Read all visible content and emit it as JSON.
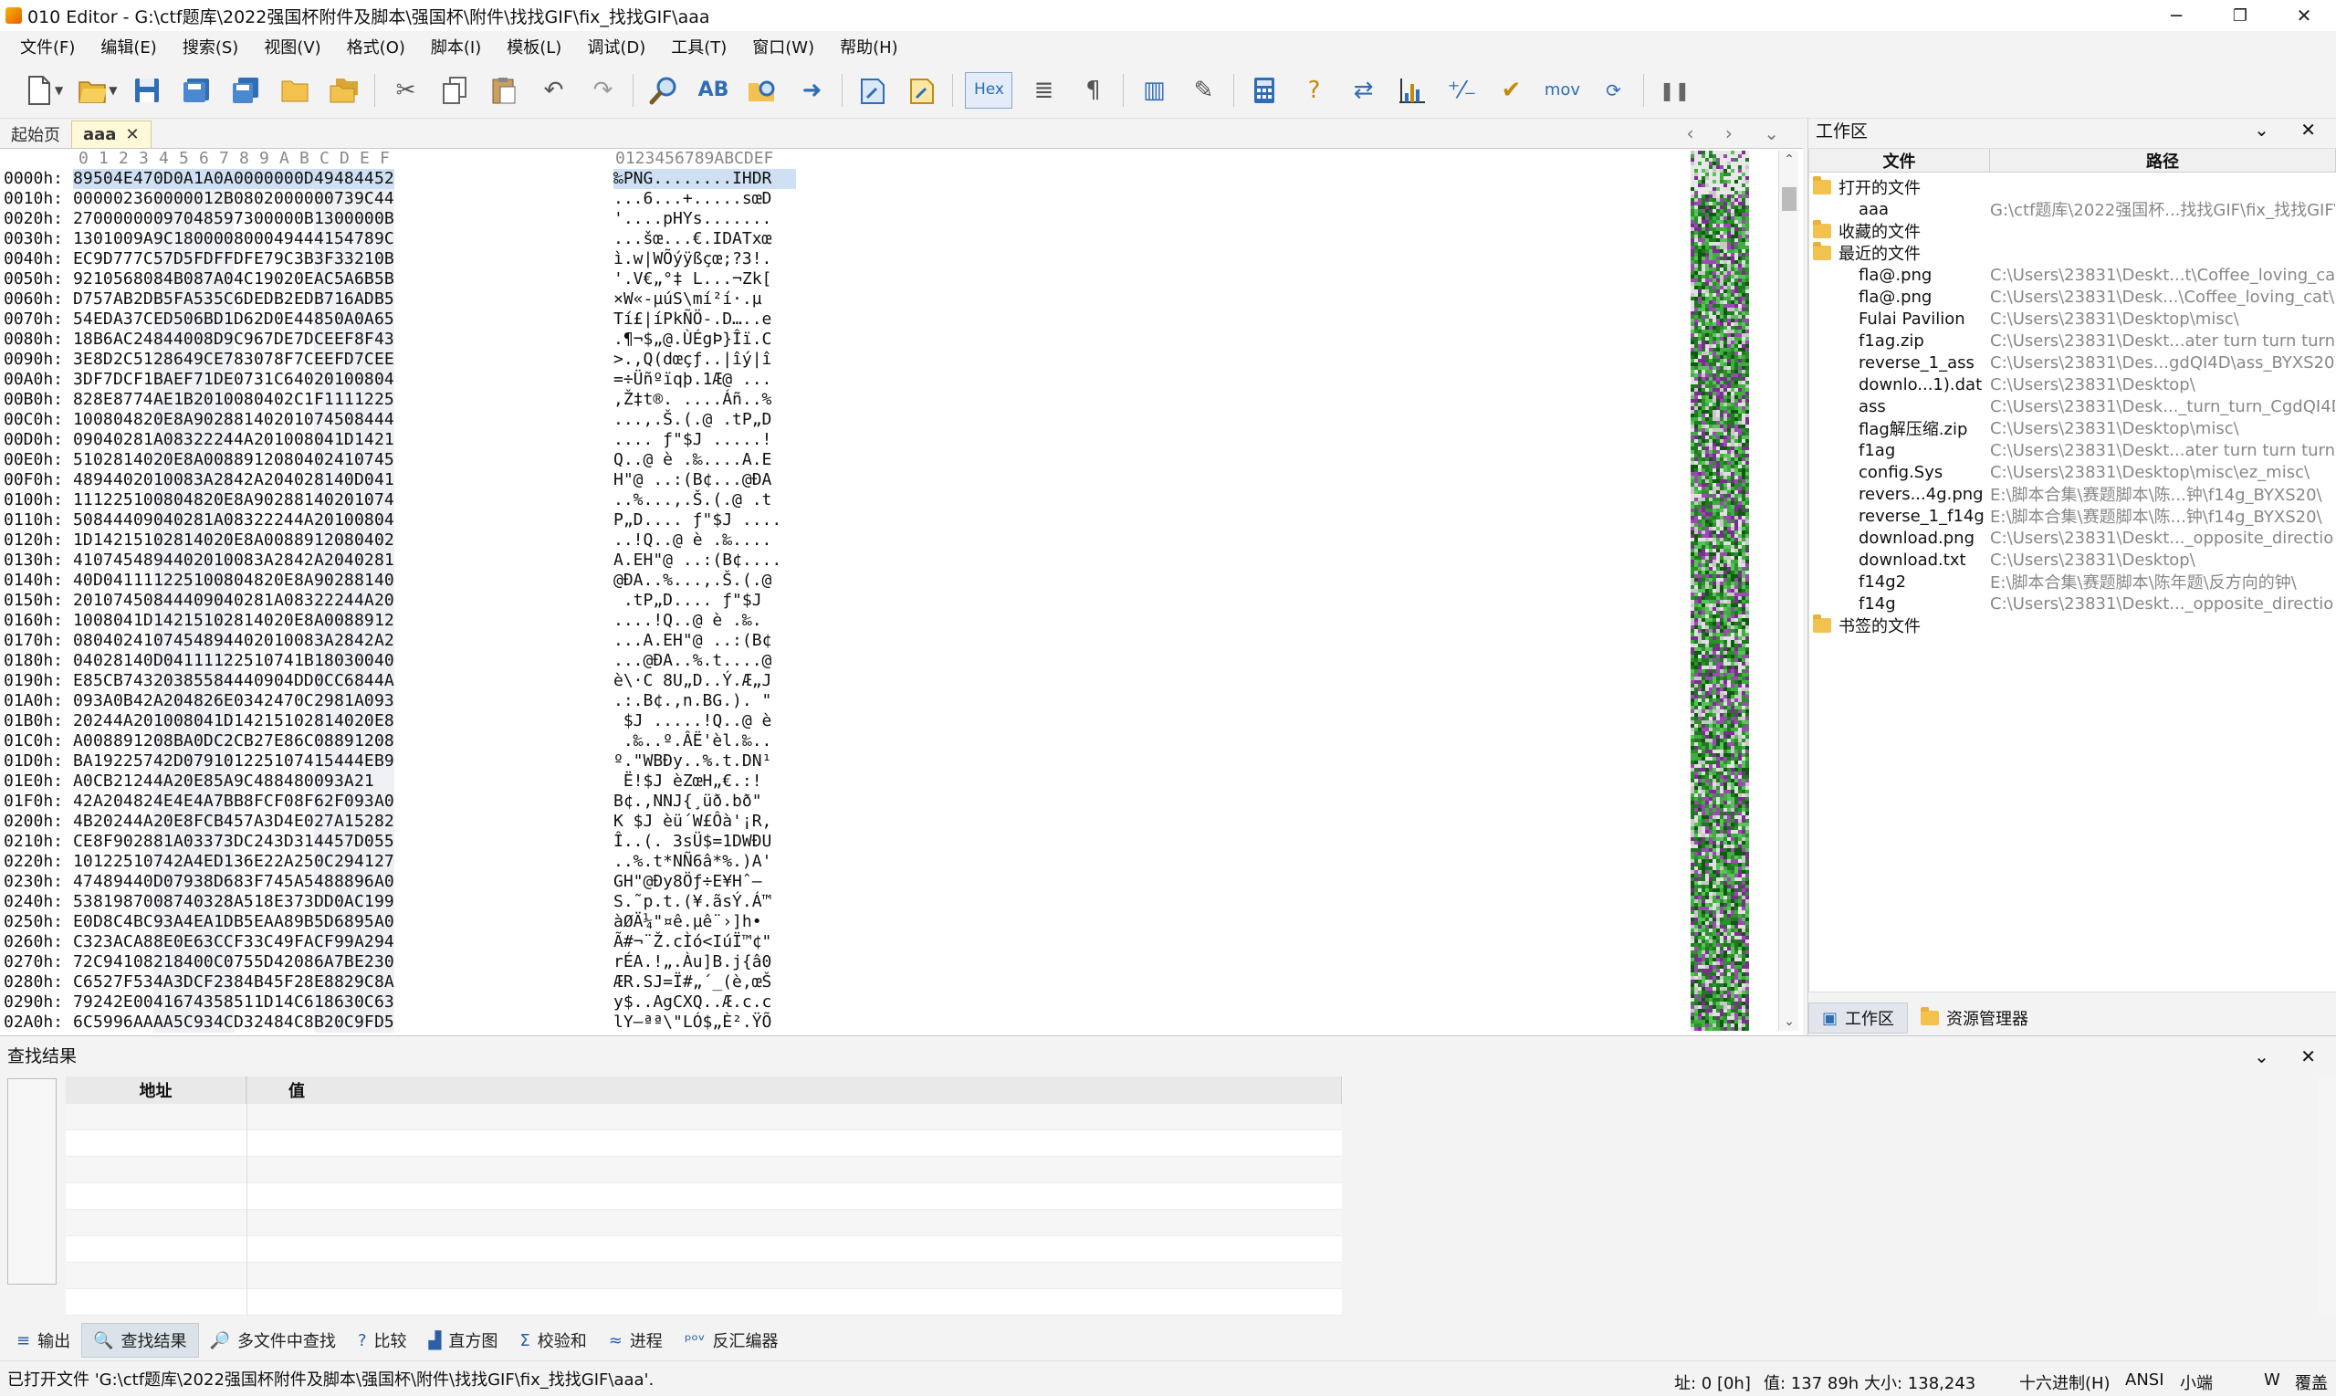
{
  "window": {
    "title": "010 Editor - G:\\ctf题库\\2022强国杯附件及脚本\\强国杯\\附件\\找找GIF\\fix_找找GIF\\aaa",
    "minimize": "─",
    "maximize": "❐",
    "close": "✕"
  },
  "menu": [
    "文件(F)",
    "编辑(E)",
    "搜索(S)",
    "视图(V)",
    "格式(O)",
    "脚本(I)",
    "模板(L)",
    "调试(D)",
    "工具(T)",
    "窗口(W)",
    "帮助(H)"
  ],
  "toolbar": {
    "hex_label": "Hex",
    "mov_label": "mov",
    "icons": [
      "new-file-icon",
      "open-file-icon",
      "save-icon",
      "save-as-icon",
      "save-all-icon",
      "open-folder-icon",
      "open-multiple-icon",
      "cut-icon",
      "copy-icon",
      "paste-icon",
      "undo-icon",
      "redo-icon",
      "find-icon",
      "find-replace-icon",
      "find-in-files-icon",
      "goto-icon",
      "run-script-icon",
      "run-template-icon",
      "hex-mode-icon",
      "line-wrap-icon",
      "show-whitespace-icon",
      "columns-icon",
      "highlight-icon",
      "calculator-icon",
      "inspector-icon",
      "compare-icon",
      "histogram-icon",
      "checksum-icon",
      "verify-icon",
      "disassembler-icon",
      "base-converter-icon",
      "pause-icon"
    ]
  },
  "tabs": [
    {
      "label": "起始页",
      "active": false
    },
    {
      "label": "aaa",
      "active": true,
      "close": "✕"
    }
  ],
  "tab_nav": "‹ › ⌄",
  "hex": {
    "column_header": [
      "0",
      "1",
      "2",
      "3",
      "4",
      "5",
      "6",
      "7",
      "8",
      "9",
      "A",
      "B",
      "C",
      "D",
      "E",
      "F"
    ],
    "ascii_header": "0123456789ABCDEF",
    "rows": [
      {
        "addr": "0000h:",
        "bytes": "89 50 4E 47 0D 0A 1A 0A 00 00 00 0D 49 48 44 52",
        "ascii": "‰PNG........IHDR"
      },
      {
        "addr": "0010h:",
        "bytes": "00 00 02 36 00 00 01 2B 08 02 00 00 00 73 9C 44",
        "ascii": "...6...+.....sœD"
      },
      {
        "addr": "0020h:",
        "bytes": "27 00 00 00 09 70 48 59 73 00 00 0B 13 00 00 0B",
        "ascii": "'....pHYs......."
      },
      {
        "addr": "0030h:",
        "bytes": "13 01 00 9A 9C 18 00 00 80 00 49 44 41 54 78 9C",
        "ascii": "...šœ...€.IDATxœ"
      },
      {
        "addr": "0040h:",
        "bytes": "EC 9D 77 7C 57 D5 FD FF DF E7 9C 3B 3F 33 21 0B",
        "ascii": "ì.w|WÕýÿßçœ;?3!."
      },
      {
        "addr": "0050h:",
        "bytes": "92 10 56 80 84 B0 87 A0 4C 19 02 0E AC 5A 6B 5B",
        "ascii": "'.V€„°‡ L...¬Zk["
      },
      {
        "addr": "0060h:",
        "bytes": "D7 57 AB 2D B5 FA 53 5C 6D ED B2 ED B7 16 AD B5",
        "ascii": "×W«-µúS\\mí²í·.­µ"
      },
      {
        "addr": "0070h:",
        "bytes": "54 ED A3 7C ED 50 6B D1 D6 2D 0E 44 85 0A 0A 65",
        "ascii": "Tí£|íPkÑÖ-.D…..e"
      },
      {
        "addr": "0080h:",
        "bytes": "18 B6 AC 24 84 40 08 D9 C9 67 DE 7D CE EF 8F 43",
        "ascii": ".¶¬$„@.ÙÉgÞ}Îï.C"
      },
      {
        "addr": "0090h:",
        "bytes": "3E 8D 2C 51 28 64 9C E7 83 07 8F 7C EE FD 7C EE",
        "ascii": ">.,Q(dœçƒ..|îý|î"
      },
      {
        "addr": "00A0h:",
        "bytes": "3D F7 DC F1 BA EF 71 DE 07 31 C6 40 20 10 08 04",
        "ascii": "=÷Üñºïqþ.1Æ@ ..."
      },
      {
        "addr": "00B0h:",
        "bytes": "82 8E 87 74 AE 1B 20 10 08 04 02 C1 F1 11 12 25",
        "ascii": ",Ž‡t®. ....Áñ..%"
      },
      {
        "addr": "00C0h:",
        "bytes": "10 08 04 82 0E 8A 90 28 81 40 20 10 74 50 84 44",
        "ascii": "...,.Š.(.@ .tP„D"
      },
      {
        "addr": "00D0h:",
        "bytes": "09 04 02 81 A0 83 22 24 4A 20 10 08 04 1D 14 21",
        "ascii": ".... ƒ\"$J .....!"
      },
      {
        "addr": "00E0h:",
        "bytes": "51 02 81 40 20 E8 A0 08 89 12 08 04 02 41 07 45",
        "ascii": "Q..@ è .‰....A.E"
      },
      {
        "addr": "00F0h:",
        "bytes": "48 94 40 20 10 08 3A 28 42 A2 04 02 81 40 D0 41",
        "ascii": "H\"@ ..:(B¢...@ÐA"
      },
      {
        "addr": "0100h:",
        "bytes": "11 12 25 10 08 04 82 0E 8A 90 28 81 40 20 10 74",
        "ascii": "..%...,.Š.(.@ .t"
      },
      {
        "addr": "0110h:",
        "bytes": "50 84 44 09 04 02 81 A0 83 22 24 4A 20 10 08 04",
        "ascii": "P„D.... ƒ\"$J ...."
      },
      {
        "addr": "0120h:",
        "bytes": "1D 14 21 51 02 81 40 20 E8 A0 08 89 12 08 04 02",
        "ascii": "..!Q..@ è .‰...."
      },
      {
        "addr": "0130h:",
        "bytes": "41 07 45 48 94 40 20 10 08 3A 28 42 A2 04 02 81",
        "ascii": "A.EH\"@ ..:(B¢...."
      },
      {
        "addr": "0140h:",
        "bytes": "40 D0 41 11 12 25 10 08 04 82 0E 8A 90 28 81 40",
        "ascii": "@ÐA..%...,.Š.(.@"
      },
      {
        "addr": "0150h:",
        "bytes": "20 10 74 50 84 44 09 04 02 81 A0 83 22 24 4A 20",
        " ascii": "",
        "ascii": " .tP„D.... ƒ\"$J "
      },
      {
        "addr": "0160h:",
        "bytes": "10 08 04 1D 14 21 51 02 81 40 20 E8 A0 08 89 12",
        "ascii": "....!Q..@ è .‰."
      },
      {
        "addr": "0170h:",
        "bytes": "08 04 02 41 07 45 48 94 40 20 10 08 3A 28 42 A2",
        "ascii": "...A.EH\"@ ..:(B¢"
      },
      {
        "addr": "0180h:",
        "bytes": "04 02 81 40 D0 41 11 12 25 10 74 1B 18 03 00 40",
        "ascii": "...@ÐA..%.t....@"
      },
      {
        "addr": "0190h:",
        "bytes": "E8 5C B7 43 20 38 55 84 44 09 04 DD 0C C6 84 4A",
        "ascii": "è\\·C 8U„D..Ý.Æ„J"
      },
      {
        "addr": "01A0h:",
        "bytes": "09 3A 0B 42 A2 04 82 6E 03 42 47 0C 29 81 A0 93",
        "ascii": ".:.B¢.,n.BG.). \""
      },
      {
        "addr": "01B0h:",
        "bytes": "20 24 4A 20 10 08 04 1D 14 21 51 02 81 40 20 E8",
        "ascii": " $J .....!Q..@ è"
      },
      {
        "addr": "01C0h:",
        "bytes": "A0 08 89 12 08 BA 0D C2 CB 27 E8 6C 08 89 12 08",
        "ascii": " .‰..º.ÂË'èl.‰.."
      },
      {
        "addr": "01D0h:",
        "bytes": "BA 19 22 57 42 D0 79 10 12 25 10 74 15 44 4E B9",
        "ascii": "º.\"WBÐy..%.t.DN¹"
      },
      {
        "addr": "01E0h:",
        "bytes": "A0 CB 21 24 4A 20 E8 5A 9C 48 84 80 09 3A 21",
        " ascii": "",
        "ascii": " Ë!$J èZœH„€.:!"
      },
      {
        "addr": "01F0h:",
        "bytes": "42 A2 04 82 4E 4E 4A 7B B8 FC F0 8F 62 F0 93 A0",
        "ascii": "B¢.,NNJ{¸üð.bð\" "
      },
      {
        "addr": "0200h:",
        "bytes": "4B 20 24 4A 20 E8 FC B4 57 A3 D4 E0 27 A1 52 82",
        "ascii": "K $J èü´W£Ôà'¡R,"
      },
      {
        "addr": "0210h:",
        "bytes": "CE 8F 90 28 81 A0 33 73 DC 24 3D 31 44 57 D0 55",
        "ascii": "Î..(. 3sÜ$=1DWÐU"
      },
      {
        "addr": "0220h:",
        "bytes": "10 12 25 10 74 2A 4E D1 36 E2 2A 25 0C 29 41 27",
        "ascii": "..%.t*NÑ6â*%.)A'"
      },
      {
        "addr": "0230h:",
        "bytes": "47 48 94 40 D0 79 38 D6 83 F7 45 A5 48 88 96 A0",
        "ascii": "GH\"@Ðy8Öƒ÷E¥Hˆ– "
      },
      {
        "addr": "0240h:",
        "bytes": "53 81 98 70 08 74 03 28 A5 18 E3 73 DD 0A C1 99",
        "ascii": "S.˜p.t.(¥.ãsÝ.Á™"
      },
      {
        "addr": "0250h:",
        "bytes": "E0 D8 C4 BC 93 A4 EA 1D B5 EA A8 9B 5D 68 95 A0",
        "ascii": "àØÄ¼\"¤ê.µê¨›]h• "
      },
      {
        "addr": "0260h:",
        "bytes": "C3 23 AC A8 8E 0E 63 CC F3 3C 49 FA CF 99 A2 94",
        "ascii": "Ã#¬¨Ž.cÌó<IúÏ™¢\""
      },
      {
        "addr": "0270h:",
        "bytes": "72 C9 41 08 21 84 00 C0 75 5D 42 08 6A 7B E2 30",
        "ascii": "rÉA.!„.Àu]B.j{â0"
      },
      {
        "addr": "0280h:",
        "bytes": "C6 52 7F 53 4A 3D CF 23 84 B4 5F 28 E8 82 9C 8A",
        "ascii": "ÆR.SJ=Ï#„´_(è,œŠ"
      },
      {
        "addr": "0290h:",
        "bytes": "79 24 2E 00 41 67 43 58 51 1D 14 C6 18 63 0C 63",
        "ascii": "y$..AgCXQ..Æ.c.c"
      },
      {
        "addr": "02A0h:",
        "bytes": "6C 59 96 AA AA 5C 93 4C D3 24 84 C8 B2 0C 9F D5",
        "ascii": "lY–ªª\\\"LÓ$„È².ŸÕ"
      }
    ]
  },
  "workspace": {
    "title": "工作区",
    "ctl": "⌄ ✕",
    "col_file": "文件",
    "col_path": "路径",
    "groups": {
      "open": "打开的文件",
      "favorites": "收藏的文件",
      "recent": "最近的文件",
      "bookmarks": "书签的文件"
    },
    "open_files": [
      {
        "name": "aaa",
        "path": "G:\\ctf题库\\2022强国杯...找找GIF\\fix_找找GIF\\"
      }
    ],
    "recent_files": [
      {
        "name": "fla@.png",
        "path": "C:\\Users\\23831\\Deskt...t\\Coffee_loving_cat\\"
      },
      {
        "name": "fla@.png",
        "path": "C:\\Users\\23831\\Desk...\\Coffee_loving_cat\\"
      },
      {
        "name": "Fulai Pavilion",
        "path": "C:\\Users\\23831\\Desktop\\misc\\"
      },
      {
        "name": "f1ag.zip",
        "path": "C:\\Users\\23831\\Deskt...ater turn turn turn\\"
      },
      {
        "name": "reverse_1_ass",
        "path": "C:\\Users\\23831\\Des...gdQI4D\\ass_BYXS20\\"
      },
      {
        "name": "downlo...1).dat",
        "path": "C:\\Users\\23831\\Desktop\\"
      },
      {
        "name": "ass",
        "path": "C:\\Users\\23831\\Desk..._turn_turn_CgdQI4D\\"
      },
      {
        "name": "flag解压缩.zip",
        "path": "C:\\Users\\23831\\Desktop\\misc\\"
      },
      {
        "name": "f1ag",
        "path": "C:\\Users\\23831\\Deskt...ater turn turn turn\\"
      },
      {
        "name": "config.Sys",
        "path": "C:\\Users\\23831\\Desktop\\misc\\ez_misc\\"
      },
      {
        "name": "revers...4g.png",
        "path": "E:\\脚本合集\\赛题脚本\\陈...钟\\f14g_BYXS20\\"
      },
      {
        "name": "reverse_1_f14g",
        "path": "E:\\脚本合集\\赛题脚本\\陈...钟\\f14g_BYXS20\\"
      },
      {
        "name": "download.png",
        "path": "C:\\Users\\23831\\Deskt..._opposite_direction\\"
      },
      {
        "name": "download.txt",
        "path": "C:\\Users\\23831\\Desktop\\"
      },
      {
        "name": "f14g2",
        "path": "E:\\脚本合集\\赛题脚本\\陈年题\\反方向的钟\\"
      },
      {
        "name": "f14g",
        "path": "C:\\Users\\23831\\Deskt..._opposite_direction\\"
      }
    ],
    "tabs": [
      {
        "label": "工作区",
        "active": true
      },
      {
        "label": "资源管理器",
        "active": false
      }
    ]
  },
  "find": {
    "title": "查找结果",
    "ctl": "⌄ ✕",
    "col_addr": "地址",
    "col_value": "值"
  },
  "bottom_tabs": [
    {
      "label": "输出",
      "icon": "≡",
      "active": false
    },
    {
      "label": "查找结果",
      "icon": "🔍",
      "active": true
    },
    {
      "label": "多文件中查找",
      "icon": "🔎",
      "active": false
    },
    {
      "label": "比较",
      "icon": "?",
      "active": false
    },
    {
      "label": "直方图",
      "icon": "▟",
      "active": false
    },
    {
      "label": "校验和",
      "icon": "Σ",
      "active": false
    },
    {
      "label": "进程",
      "icon": "≈",
      "active": false
    },
    {
      "label": "反汇编器",
      "icon": "ᵖᵒᵛ",
      "active": false
    }
  ],
  "status": {
    "message": "已打开文件 'G:\\ctf题库\\2022强国杯附件及脚本\\强国杯\\附件\\找找GIF\\fix_找找GIF\\aaa'.",
    "addr": "址: 0 [0h]",
    "value": "值: 137 89h",
    "size": "大小: 138,243",
    "mode": "十六进制(H)",
    "encoding": "ANSI",
    "endian": "小端",
    "w": "W",
    "overwrite": "覆盖"
  }
}
